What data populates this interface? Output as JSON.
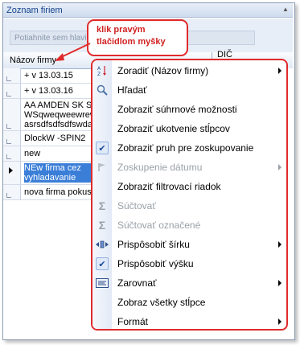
{
  "window": {
    "title": "Zoznam firiem"
  },
  "group_panel": {
    "hint": "Potiahnite sem hlavičku stĺpca pre zoskupenie"
  },
  "columns": {
    "name": "Názov firmy",
    "dic": "DIČ"
  },
  "rows": [
    {
      "text": "+ v 13.03.15"
    },
    {
      "text": "+ v 13.03.16"
    },
    {
      "text": "AA AMDEN SK S\nWSqweqweewrew\nasrsdfsdfsdfswdas"
    },
    {
      "text": "DlockW -SPIN2"
    },
    {
      "text": "new"
    },
    {
      "text": "NEw firma cez\nvyhladavanie"
    },
    {
      "text": "nova firma pokus"
    }
  ],
  "callout": {
    "line1": "klik pravým",
    "line2": "tlačidlom myšky"
  },
  "context_menu": {
    "items": [
      {
        "label": "Zoradiť (Názov firmy)",
        "icon": "sort-icon",
        "submenu": true,
        "disabled": false,
        "checked": false
      },
      {
        "label": "Hľadať",
        "icon": "search-icon",
        "submenu": false,
        "disabled": false,
        "checked": false
      },
      {
        "label": "Zobraziť súhrnové možnosti",
        "icon": "",
        "submenu": false,
        "disabled": false,
        "checked": false
      },
      {
        "label": "Zobraziť ukotvenie stĺpcov",
        "icon": "",
        "submenu": false,
        "disabled": false,
        "checked": false
      },
      {
        "label": "Zobraziť pruh pre zoskupovanie",
        "icon": "check-icon",
        "submenu": false,
        "disabled": false,
        "checked": true
      },
      {
        "label": "Zoskupenie dátumu",
        "icon": "flag-icon",
        "submenu": true,
        "disabled": true,
        "checked": false
      },
      {
        "label": "Zobraziť filtrovací riadok",
        "icon": "",
        "submenu": false,
        "disabled": false,
        "checked": false
      },
      {
        "label": "Súčtovať",
        "icon": "sigma-icon",
        "submenu": false,
        "disabled": true,
        "checked": false
      },
      {
        "label": "Súčtovať označené",
        "icon": "sigma-icon",
        "submenu": false,
        "disabled": true,
        "checked": false
      },
      {
        "label": "Prispôsobiť šírku",
        "icon": "fit-width-icon",
        "submenu": true,
        "disabled": false,
        "checked": false
      },
      {
        "label": "Prispôsobiť výšku",
        "icon": "check-icon",
        "submenu": false,
        "disabled": false,
        "checked": true
      },
      {
        "label": "Zarovnať",
        "icon": "align-icon",
        "submenu": true,
        "disabled": false,
        "checked": false
      },
      {
        "label": "Zobraz všetky stĺpce",
        "icon": "",
        "submenu": false,
        "disabled": false,
        "checked": false
      },
      {
        "label": "Formát",
        "icon": "",
        "submenu": true,
        "disabled": false,
        "checked": false
      }
    ]
  },
  "colors": {
    "accent_red": "#e02b2b",
    "selection_blue": "#3b7ed8"
  }
}
